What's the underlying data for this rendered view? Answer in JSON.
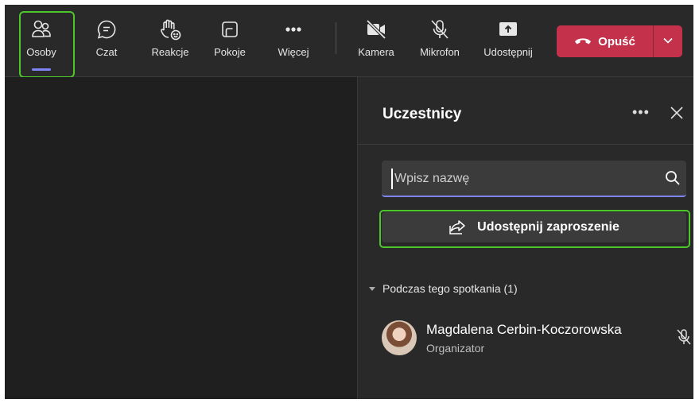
{
  "toolbar": {
    "people_label": "Osoby",
    "chat_label": "Czat",
    "react_label": "Reakcje",
    "rooms_label": "Pokoje",
    "more_label": "Więcej",
    "camera_label": "Kamera",
    "mic_label": "Mikrofon",
    "share_label": "Udostępnij",
    "leave_label": "Opuść"
  },
  "panel": {
    "title": "Uczestnicy",
    "search_placeholder": "Wpisz nazwę",
    "invite_label": "Udostępnij zaproszenie",
    "section_label": "Podczas tego spotkania (1)",
    "participants": [
      {
        "name": "Magdalena Cerbin-Koczorowska",
        "role": "Organizator",
        "muted": true
      }
    ]
  },
  "colors": {
    "accent": "#7f85f5",
    "leave": "#c4314b",
    "highlight": "#4cc62a"
  },
  "icons": [
    "people-icon",
    "chat-icon",
    "raise-hand-icon",
    "rooms-icon",
    "more-icon",
    "camera-off-icon",
    "mic-off-icon",
    "share-screen-icon",
    "phone-hangup-icon",
    "chevron-down-icon",
    "ellipsis-icon",
    "close-icon",
    "search-icon",
    "share-icon",
    "caret-down-icon"
  ]
}
